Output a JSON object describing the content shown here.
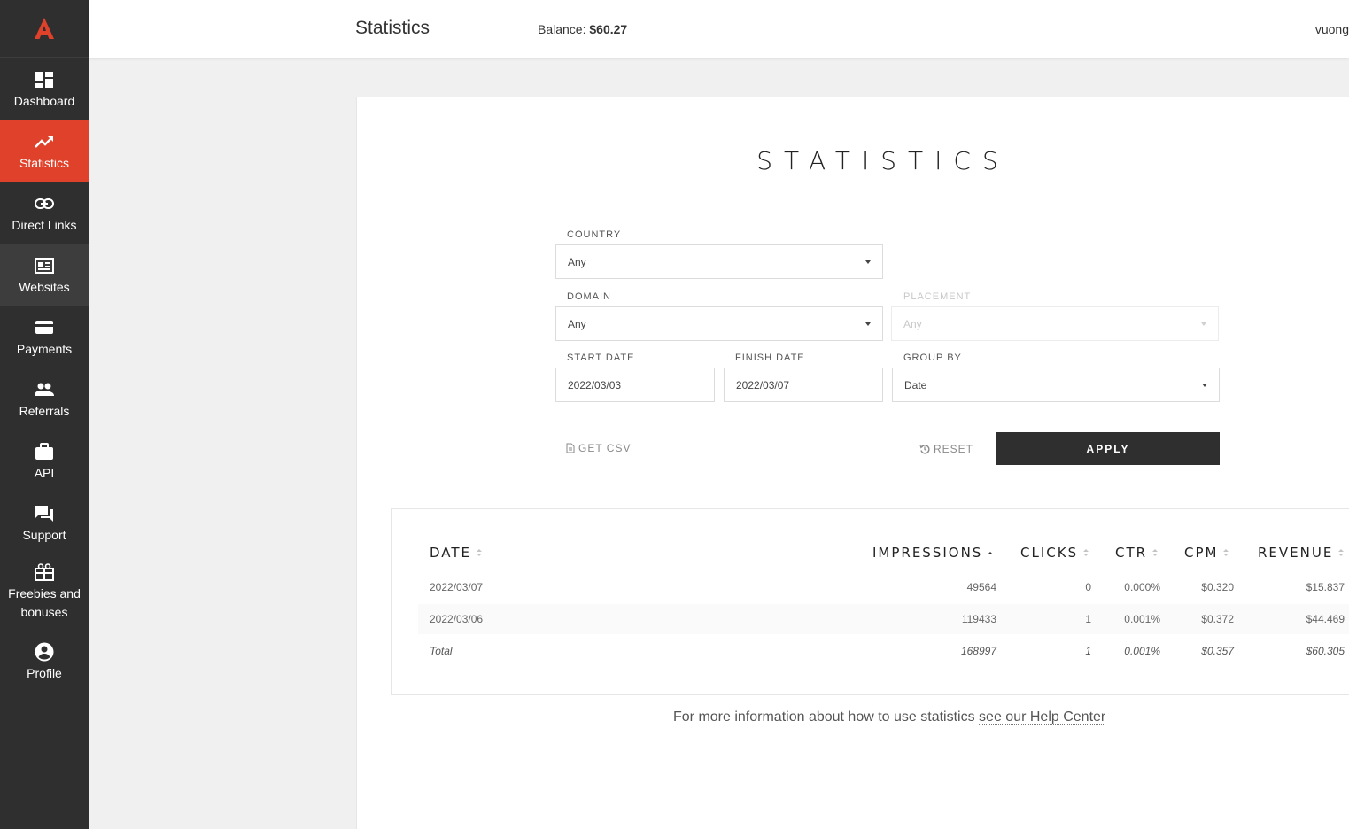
{
  "sidebar": {
    "items": [
      {
        "label": "Dashboard",
        "icon": "dashboard-icon"
      },
      {
        "label": "Statistics",
        "icon": "trending-up-icon"
      },
      {
        "label": "Direct Links",
        "icon": "link-icon"
      },
      {
        "label": "Websites",
        "icon": "website-icon"
      },
      {
        "label": "Payments",
        "icon": "credit-card-icon"
      },
      {
        "label": "Referrals",
        "icon": "people-icon"
      },
      {
        "label": "API",
        "icon": "briefcase-icon"
      },
      {
        "label": "Support",
        "icon": "chat-icon"
      },
      {
        "label": "Freebies and bonuses",
        "icon": "gift-icon"
      },
      {
        "label": "Profile",
        "icon": "account-circle-icon"
      }
    ]
  },
  "header": {
    "title": "Statistics",
    "balance_label": "Balance:",
    "balance_value": "$60.27",
    "user": "vuong"
  },
  "page": {
    "title": "STATISTICS"
  },
  "filters": {
    "country": {
      "label": "COUNTRY",
      "value": "Any"
    },
    "domain": {
      "label": "DOMAIN",
      "value": "Any"
    },
    "placement": {
      "label": "PLACEMENT",
      "value": "Any"
    },
    "start_date": {
      "label": "START DATE",
      "value": "2022/03/03"
    },
    "finish_date": {
      "label": "FINISH DATE",
      "value": "2022/03/07"
    },
    "group_by": {
      "label": "GROUP BY",
      "value": "Date"
    }
  },
  "actions": {
    "get_csv": "GET CSV",
    "reset": "RESET",
    "apply": "APPLY"
  },
  "table": {
    "headers": [
      "DATE",
      "IMPRESSIONS",
      "CLICKS",
      "CTR",
      "CPM",
      "REVENUE"
    ],
    "rows": [
      [
        "2022/03/07",
        "49564",
        "0",
        "0.000%",
        "$0.320",
        "$15.837"
      ],
      [
        "2022/03/06",
        "119433",
        "1",
        "0.001%",
        "$0.372",
        "$44.469"
      ]
    ],
    "total": [
      "Total",
      "168997",
      "1",
      "0.001%",
      "$0.357",
      "$60.305"
    ]
  },
  "help": {
    "text": "For more information about how to use statistics",
    "link": "see our Help Center"
  },
  "colors": {
    "accent": "#e0412b",
    "sidebar": "#2f2f2f",
    "button": "#2f2f2f"
  }
}
